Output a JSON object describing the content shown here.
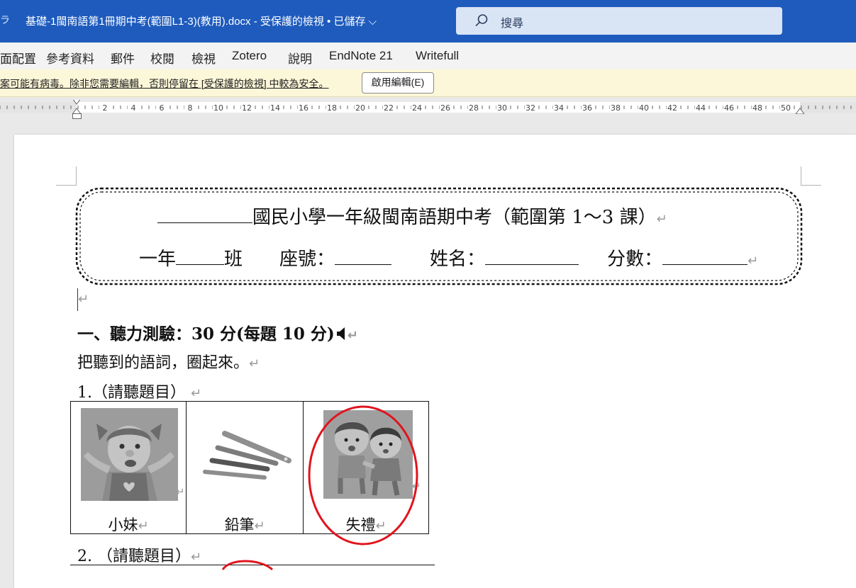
{
  "titlebar": {
    "left_glyph": "ラ",
    "document_title": "基礎-1閩南語第1冊期中考(範圍L1-3)(教用).docx  -  受保護的檢視 • 已儲存 ⌵",
    "search_label": "搜尋"
  },
  "ribbon": {
    "tabs": [
      "面配置",
      "參考資料",
      "郵件",
      "校閱",
      "檢視",
      "Zotero",
      "說明",
      "EndNote 21",
      "Writefull"
    ]
  },
  "message_bar": {
    "text": "案可能有病毒。除非您需要編輯，否則停留在 [受保護的檢視] 中較為安全。",
    "button_label": "啟用編輯(E)"
  },
  "ruler": {
    "labels": [
      "2",
      "4",
      "6",
      "8",
      "10",
      "12",
      "14",
      "16",
      "18",
      "20",
      "22",
      "24",
      "26",
      "28",
      "30",
      "32",
      "34",
      "36",
      "38",
      "40",
      "42",
      "44",
      "46",
      "48",
      "50"
    ]
  },
  "document": {
    "header_line1_text": "國民小學一年級閩南語期中考（範圍第 1～3 課）",
    "header_line2": {
      "grade": "一年",
      "class": "班",
      "seat": "座號：",
      "name": "姓名：",
      "score": "分數："
    },
    "paragraph_mark": "↵",
    "section1_title": "一、聽力測驗：30 分(每題 10 分)",
    "speaker_icon": "speaker-icon",
    "instruction": "把聽到的語詞，圈起來。",
    "q1_label": "1.（請聽題目）",
    "q1_options": [
      "小妹",
      "鉛筆",
      "失禮"
    ],
    "q1_answer": "失禮",
    "q2_label": "2. （請聽題目）",
    "answer_circle_color": "#e0141e"
  }
}
